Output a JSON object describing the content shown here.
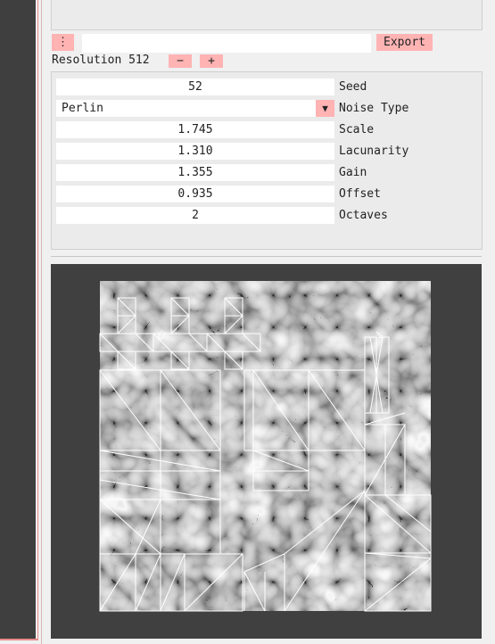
{
  "toolbar": {
    "menu_glyph": "⋮",
    "name_value": "",
    "export_label": "Export"
  },
  "resolution": {
    "label": "Resolution 512",
    "minus_label": "−",
    "plus_label": "+"
  },
  "params": {
    "seed": {
      "value": "52",
      "label": "Seed"
    },
    "noise_type": {
      "value": "Perlin",
      "label": "Noise Type",
      "arrow": "▼"
    },
    "scale": {
      "value": "1.745",
      "label": "Scale"
    },
    "lacunarity": {
      "value": "1.310",
      "label": "Lacunarity"
    },
    "gain": {
      "value": "1.355",
      "label": "Gain"
    },
    "offset": {
      "value": "0.935",
      "label": "Offset"
    },
    "octaves": {
      "value": "2",
      "label": "Octaves"
    }
  },
  "colors": {
    "accent": "#ffb3b3",
    "sidebar": "#3f3f3f",
    "preview_bg": "#404040"
  }
}
